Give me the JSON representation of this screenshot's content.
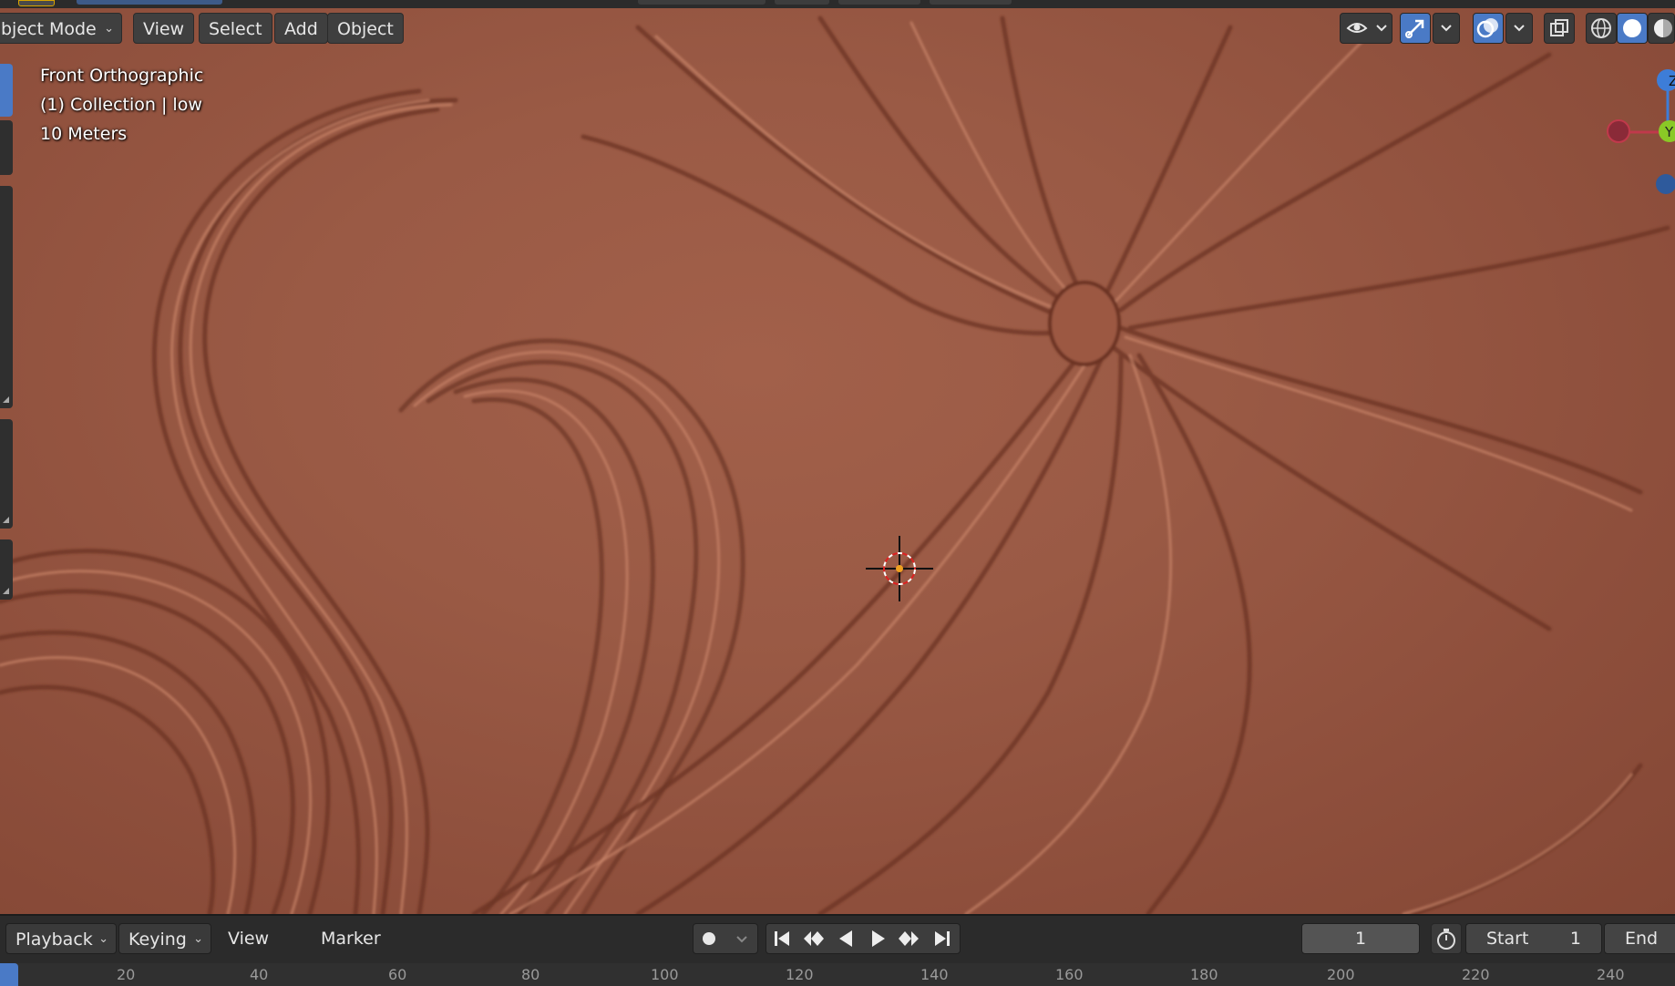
{
  "header": {
    "mode_label": "bject Mode",
    "menus": [
      "View",
      "Select",
      "Add",
      "Object"
    ]
  },
  "overlay": {
    "view_name": "Front Orthographic",
    "collection": "(1) Collection | low",
    "scale": "10 Meters"
  },
  "gizmo": {
    "z_label": "Z",
    "y_label": "Y"
  },
  "timeline": {
    "playback_label": "Playback",
    "keying_label": "Keying",
    "view_label": "View",
    "marker_label": "Marker",
    "current_frame": "1",
    "start_label": "Start",
    "start_value": "1",
    "end_label": "End",
    "ruler_ticks": [
      "20",
      "40",
      "60",
      "80",
      "100",
      "120",
      "140",
      "160",
      "180",
      "200",
      "220",
      "240"
    ]
  },
  "icons": {
    "record": "record-icon",
    "jump_start": "jump-start-icon",
    "prev_keyframe": "prev-keyframe-icon",
    "play_reverse": "play-reverse-icon",
    "play": "play-icon",
    "next_keyframe": "next-keyframe-icon",
    "jump_end": "jump-end-icon",
    "stopwatch": "stopwatch-icon",
    "visibility": "eye-icon",
    "gizmo_toggle": "gizmo-icon",
    "overlay_toggle": "overlays-icon",
    "xray": "xray-icon",
    "wireframe": "wireframe-shading-icon",
    "solid": "solid-shading-icon",
    "material": "material-shading-icon"
  },
  "colors": {
    "surface": "#9a5a45",
    "header_button": "#3f3f3f",
    "active_toggle": "#4a7ac6",
    "axis_x": "#c0394b",
    "axis_y": "#8ac926",
    "axis_z": "#3d7dd8"
  }
}
